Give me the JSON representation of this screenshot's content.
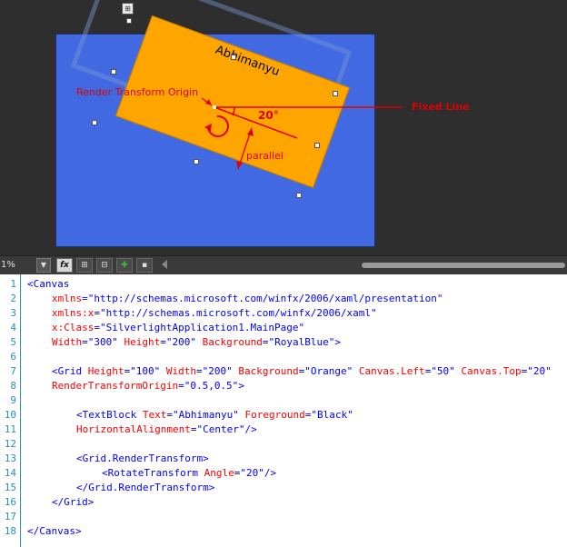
{
  "design_view": {
    "textblock_text": "Abhimanyu",
    "annotations": {
      "origin_label": "Render Transform Origin",
      "angle_label": "20°",
      "fixed_line_label": "Fixed Line",
      "parallel_label": "parallel"
    },
    "colors": {
      "canvas_bg": "#4169E1",
      "grid_bg": "#FFA500",
      "annotation": "#e00000"
    }
  },
  "toolbar": {
    "zoom_value": "1%",
    "buttons": [
      "fx-icon",
      "grid-icon",
      "snap-grid-icon",
      "snap-lines-icon",
      "annotation-icon"
    ]
  },
  "code": {
    "line_numbers": [
      "1",
      "2",
      "3",
      "4",
      "5",
      "6",
      "7",
      "8",
      "9",
      "10",
      "11",
      "12",
      "13",
      "14",
      "15",
      "16",
      "17",
      "18"
    ],
    "lines": {
      "l1": {
        "t1": "<Canvas"
      },
      "l2": {
        "a1": "xmlns",
        "p1": "=",
        "v1": "\"http://schemas.microsoft.com/winfx/2006/xaml/presentation\""
      },
      "l3": {
        "a1": "xmlns:x",
        "p1": "=",
        "v1": "\"http://schemas.microsoft.com/winfx/2006/xaml\""
      },
      "l4": {
        "a1": "x:Class",
        "p1": "=",
        "v1": "\"SilverlightApplication1.MainPage\""
      },
      "l5": {
        "a1": "Width",
        "p1": "=",
        "v1": "\"300\"",
        "a2": " Height",
        "p2": "=",
        "v2": "\"200\"",
        "a3": " Background",
        "p3": "=",
        "v3": "\"RoyalBlue\"",
        "t1": ">"
      },
      "l7": {
        "t1": "<Grid",
        "a1": " Height",
        "p1": "=",
        "v1": "\"100\"",
        "a2": " Width",
        "p2": "=",
        "v2": "\"200\"",
        "a3": " Background",
        "p3": "=",
        "v3": "\"Orange\"",
        "a4": " Canvas.Left",
        "p4": "=",
        "v4": "\"50\"",
        "a5": " Canvas.Top",
        "p5": "=",
        "v5": "\"20\""
      },
      "l8": {
        "a1": "RenderTransformOrigin",
        "p1": "=",
        "v1": "\"0.5,0.5\"",
        "t1": ">"
      },
      "l10": {
        "t1": "<TextBlock",
        "a1": " Text",
        "p1": "=",
        "v1": "\"Abhimanyu\"",
        "a2": " Foreground",
        "p2": "=",
        "v2": "\"Black\""
      },
      "l11": {
        "a1": "HorizontalAlignment",
        "p1": "=",
        "v1": "\"Center\"",
        "t1": "/>"
      },
      "l13": {
        "t1": "<Grid.RenderTransform>"
      },
      "l14": {
        "t1": "<RotateTransform",
        "a1": " Angle",
        "p1": "=",
        "v1": "\"20\"",
        "t2": "/>"
      },
      "l15": {
        "t1": "</Grid.RenderTransform>"
      },
      "l16": {
        "t1": "</Grid>"
      },
      "l18": {
        "t1": "</Canvas>"
      }
    },
    "colors": {
      "tag": "#0000ff",
      "element": "#a31515",
      "attribute": "#ff0000",
      "line_number": "#2b91af"
    }
  }
}
